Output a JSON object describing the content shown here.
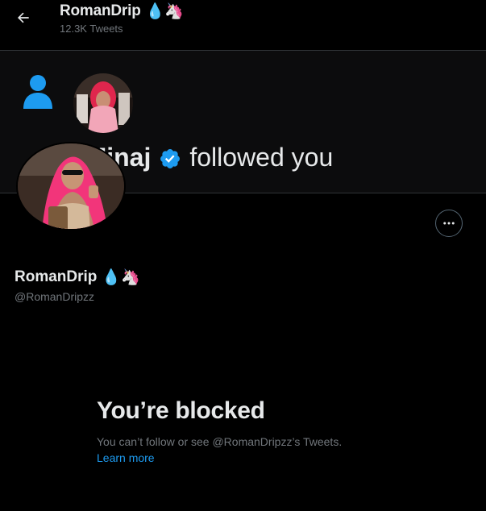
{
  "header": {
    "name": "RomanDrip",
    "emojis": "💧🦄",
    "tweet_count": "12.3K Tweets"
  },
  "banner": {
    "name_fragment": "ki Minaj",
    "followed_text": "followed you"
  },
  "profile": {
    "name": "RomanDrip",
    "emojis": "💧🦄",
    "handle": "@RomanDripzz"
  },
  "blocked": {
    "title": "You’re blocked",
    "description": "You can’t follow or see @RomanDripzz’s Tweets.",
    "learn_more": "Learn more"
  },
  "colors": {
    "accent": "#1d9bf0",
    "background": "#000000",
    "text_primary": "#e7e9ea",
    "text_secondary": "#71767b",
    "border": "#2f3336"
  },
  "icons": {
    "back": "arrow-left-icon",
    "more": "more-horizontal-icon",
    "verified": "verified-badge-icon",
    "person": "person-icon"
  }
}
